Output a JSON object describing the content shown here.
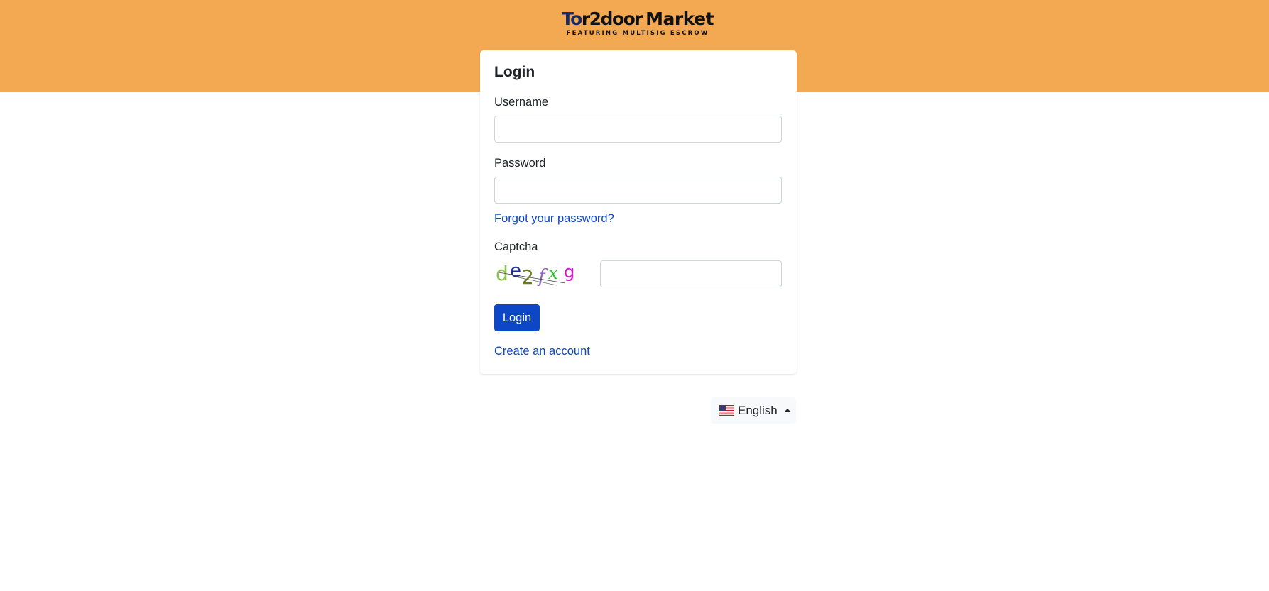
{
  "header": {
    "logo_brand_first": "To",
    "logo_brand_rest": "r2door",
    "logo_suffix": "Market",
    "logo_tagline": "FEATURING MULTISIG ESCROW",
    "background_color": "#f3a952"
  },
  "login_card": {
    "title": "Login",
    "username_label": "Username",
    "username_value": "",
    "password_label": "Password",
    "password_value": "",
    "forgot_password_link": "Forgot your password?",
    "captcha_label": "Captcha",
    "captcha_text": "de2fxg",
    "captcha_value": "",
    "login_button": "Login",
    "create_account_link": "Create an account"
  },
  "language": {
    "selected": "English",
    "flag_icon": "us-flag-icon"
  },
  "colors": {
    "accent": "#0d47c5",
    "header": "#f3a952"
  }
}
